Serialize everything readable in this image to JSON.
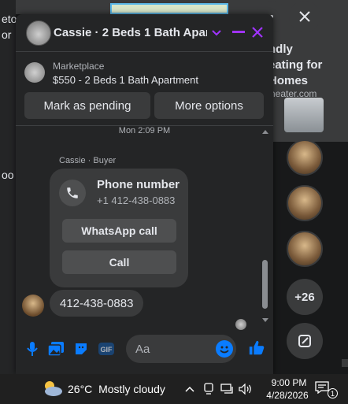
{
  "background": {
    "left_text": [
      "eto",
      "or",
      "oo"
    ],
    "ad": {
      "lines": [
        "ndly",
        "eating for",
        "Homes"
      ],
      "domain": "heater.com"
    },
    "more_count": "+26"
  },
  "chat": {
    "title": "Cassie · 2 Beds 1 Bath Apar...",
    "listing": {
      "source": "Marketplace",
      "title": "$550 - 2 Beds 1 Bath Apartment",
      "pending_label": "Mark as pending",
      "more_label": "More options"
    },
    "timestamp": "Mon 2:09 PM",
    "sender_label": "Cassie · Buyer",
    "contact_card": {
      "title": "Phone number",
      "number": "+1 412-438-0883",
      "whatsapp_label": "WhatsApp call",
      "call_label": "Call"
    },
    "message": "412-438-0883",
    "composer": {
      "placeholder": "Aa"
    }
  },
  "taskbar": {
    "temperature": "26°C",
    "weather": "Mostly cloudy",
    "time": "9:00 PM",
    "date": "4/28/2026",
    "notification_count": "1"
  },
  "colors": {
    "accent_purple": "#a033ff",
    "messenger_blue": "#0a7cff",
    "panel": "#242526",
    "surface": "#3a3b3c"
  }
}
